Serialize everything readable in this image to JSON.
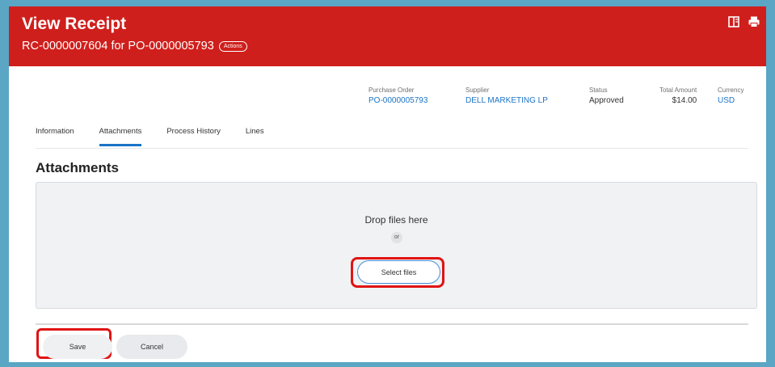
{
  "header": {
    "title": "View Receipt",
    "subtitle": "RC-0000007604 for PO-0000005793",
    "actions_label": "Actions"
  },
  "summary": [
    {
      "label": "Purchase Order",
      "value": "PO-0000005793"
    },
    {
      "label": "Supplier",
      "value": "DELL MARKETING LP"
    },
    {
      "label": "Status",
      "value": "Approved"
    },
    {
      "label": "Total Amount",
      "value": "$14.00"
    },
    {
      "label": "Currency",
      "value": "USD"
    }
  ],
  "tabs": [
    {
      "label": "Information"
    },
    {
      "label": "Attachments"
    },
    {
      "label": "Process History"
    },
    {
      "label": "Lines"
    }
  ],
  "attachments": {
    "title": "Attachments",
    "drop_text": "Drop files here",
    "or_text": "or",
    "select_label": "Select files"
  },
  "footer": {
    "save_label": "Save",
    "cancel_label": "Cancel"
  },
  "colors": {
    "header_bg": "#cf1f1c",
    "link": "#1a73c8",
    "highlight": "#e01414"
  },
  "icons": [
    "split-view-icon",
    "print-icon"
  ]
}
